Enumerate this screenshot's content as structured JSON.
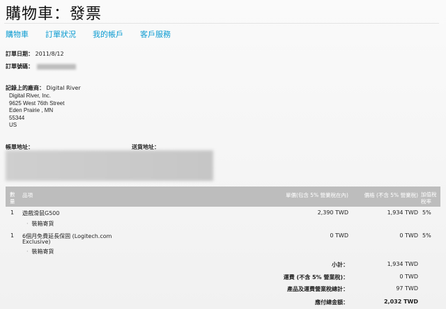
{
  "page": {
    "title": "購物車：發票"
  },
  "nav": {
    "items": [
      "購物車",
      "訂單狀況",
      "我的帳戶",
      "客戶服務"
    ]
  },
  "order": {
    "date_label": "訂單日期：",
    "date_value": "2011/8/12",
    "number_label": "訂單號碼："
  },
  "seller": {
    "label": "記錄上的廠商：",
    "name": "Digital River",
    "lines": [
      "Digital River, Inc.",
      "9625 West 76th Street",
      "Eden Prairie , MN",
      "55344",
      "US"
    ]
  },
  "addresses": {
    "billing_label": "帳單地址：",
    "shipping_label": "送貨地址："
  },
  "table": {
    "headers": {
      "qty": "數量",
      "item": "品項",
      "unit_price": "單價(包含 5% 營業稅在內)",
      "price": "價格 (不含 5% 營業稅)",
      "tax_rate": "加值稅稅率"
    },
    "rows": [
      {
        "qty": "1",
        "name_lines": [
          "遊戲滑鼠G500"
        ],
        "sub": "裝箱寄貨",
        "unit_price": "2,390 TWD",
        "price": "1,934 TWD",
        "tax": "5%"
      },
      {
        "qty": "1",
        "name_lines": [
          "6個月免費延長保固 (Logitech.com",
          "Exclusive)"
        ],
        "sub": "裝箱寄貨",
        "unit_price": "0 TWD",
        "price": "0 TWD",
        "tax": "5%"
      }
    ]
  },
  "summary": {
    "subtotal_label": "小計：",
    "subtotal": "1,934 TWD",
    "shipping_label": "運費 (不含 5% 營業稅)：",
    "shipping": "0 TWD",
    "tax_label": "產品及運費營業稅總計：",
    "tax": "97 TWD",
    "total_label": "應付總金額：",
    "total": "2,032 TWD"
  }
}
